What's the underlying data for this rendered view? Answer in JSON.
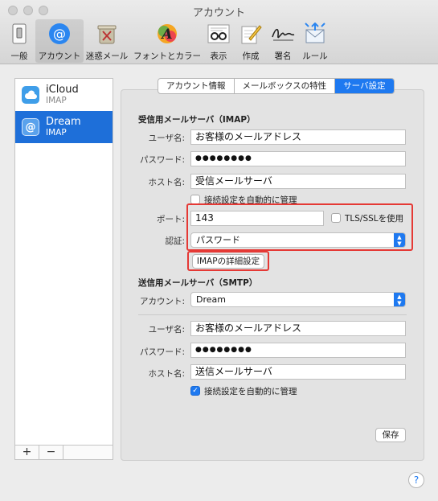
{
  "window": {
    "title": "アカウント"
  },
  "toolbar": {
    "items": [
      {
        "label": "一般",
        "icon": "switch-icon"
      },
      {
        "label": "アカウント",
        "icon": "at-sign-icon"
      },
      {
        "label": "迷惑メール",
        "icon": "trash-bin-icon"
      },
      {
        "label": "フォントとカラー",
        "icon": "font-color-icon"
      },
      {
        "label": "表示",
        "icon": "glasses-icon"
      },
      {
        "label": "作成",
        "icon": "compose-icon"
      },
      {
        "label": "署名",
        "icon": "signature-icon"
      },
      {
        "label": "ルール",
        "icon": "rules-icon"
      }
    ]
  },
  "sidebar": {
    "accounts": [
      {
        "name": "iCloud",
        "type": "IMAP",
        "icon": "cloud-icon"
      },
      {
        "name": "Dream",
        "type": "IMAP",
        "icon": "at-sign-icon"
      }
    ],
    "add_label": "+",
    "remove_label": "−"
  },
  "tabs": [
    "アカウント情報",
    "メールボックスの特性",
    "サーバ設定"
  ],
  "incoming": {
    "title": "受信用メールサーバ（IMAP）",
    "username_label": "ユーザ名:",
    "username": "お客様のメールアドレス",
    "password_label": "パスワード:",
    "password": "●●●●●●●●",
    "host_label": "ホスト名:",
    "host": "受信メールサーバ",
    "auto_manage_label": "接続設定を自動的に管理",
    "auto_manage_checked": false,
    "port_label": "ポート:",
    "port": "143",
    "tls_label": "TLS/SSLを使用",
    "tls_checked": false,
    "auth_label": "認証:",
    "auth": "パスワード",
    "advanced_button": "IMAPの詳細設定"
  },
  "outgoing": {
    "title": "送信用メールサーバ（SMTP）",
    "account_label": "アカウント:",
    "account": "Dream",
    "username_label": "ユーザ名:",
    "username": "お客様のメールアドレス",
    "password_label": "パスワード:",
    "password": "●●●●●●●●",
    "host_label": "ホスト名:",
    "host": "送信メールサーバ",
    "auto_manage_label": "接続設定を自動的に管理",
    "auto_manage_checked": true
  },
  "save_button": "保存",
  "help_label": "?",
  "colors": {
    "accent": "#1e79f0",
    "highlight_box": "#e53935"
  }
}
